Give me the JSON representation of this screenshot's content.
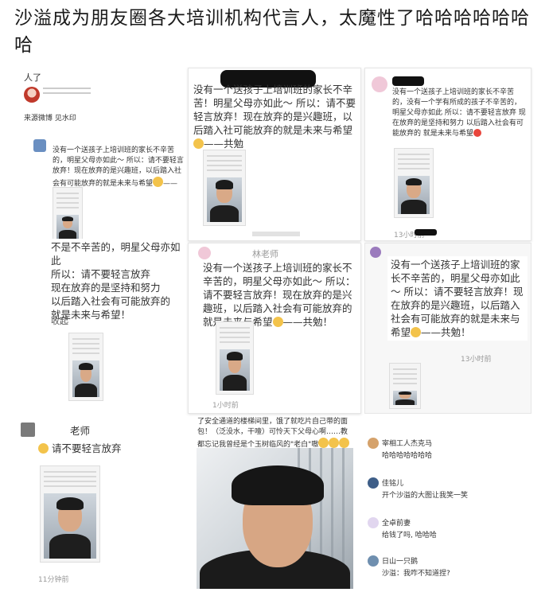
{
  "headline": "沙溢成为朋友圈各大培训机构代言人，太魔性了哈哈哈哈哈哈哈",
  "p1": {
    "title": "人了",
    "source": "来源微博 见水印",
    "post": "没有一个送孩子上培训班的家长不辛苦的，明星父母亦如此～ 所以：请不要轻言放弃！现在放弃的是兴趣班，以后踏入社会有可能放弃的就是未来与希望",
    "post_tail": "——共勉！"
  },
  "p2": {
    "post": "没有一个送孩子上培训班的家长不辛苦！明星父母亦如此～ 所以：请不要轻言放弃！现在放弃的是兴趣班，以后踏入社可能放弃的就是未来与希望",
    "post_tail": "——共勉"
  },
  "p3": {
    "post": "没有一个送孩子上培训班的家长不辛苦的，没有一个学有所成的孩子不辛苦的，明星父母亦如此 所以：请不要轻言放弃 现在放弃的是坚持和努力 以后踏入社会有可能放弃的 就是未来与希望",
    "time": "13小时前"
  },
  "p4": {
    "lines": [
      "不是不辛苦的，明星父母亦如此",
      "所以：请不要轻言放弃",
      "现在放弃的是坚持和努力",
      "以后踏入社会有可能放弃的",
      "就是未来与希望！"
    ],
    "fold": "收起"
  },
  "p5": {
    "author": "林老师",
    "post": "没有一个送孩子上培训班的家长不辛苦的，明星父母亦如此～ 所以：请不要轻言放弃！现在放弃的是兴趣班，以后踏入社会有可能放弃的就是未来与希望",
    "post_tail": "——共勉！",
    "time": "1小时前"
  },
  "p6": {
    "post": "没有一个送孩子上培训班的家长不辛苦的，明星父母亦如此～ 所以：请不要轻言放弃！现在放弃的是兴趣班，以后踏入社会有可能放弃的就是未来与希望",
    "post_tail": "——共勉！",
    "time": "13小时前"
  },
  "p7": {
    "author": "老师",
    "post": "请不要轻言放弃",
    "time": "11分钟前"
  },
  "p8": {
    "caption": "了安全通道的楼梯间里，饿了就吃片自己带的面包！（泛没水，干噎）可怜天下父母心啊……教都忘记我曾经是个玉树临风的\"老白\"嗷"
  },
  "comments": [
    {
      "name": "宰相工人杰克马",
      "text": "哈哈哈哈哈哈哈"
    },
    {
      "name": "佳铭儿",
      "text": "开个沙溢的大图让我笑一笑"
    },
    {
      "name": "全卓前妻",
      "text": "给钱了吗, 哈哈哈"
    },
    {
      "name": "日山一只鹅",
      "text": "沙溢：我咋不知道捏?"
    }
  ],
  "colors": {
    "redact": "#111111",
    "comment_name": "#333333"
  }
}
